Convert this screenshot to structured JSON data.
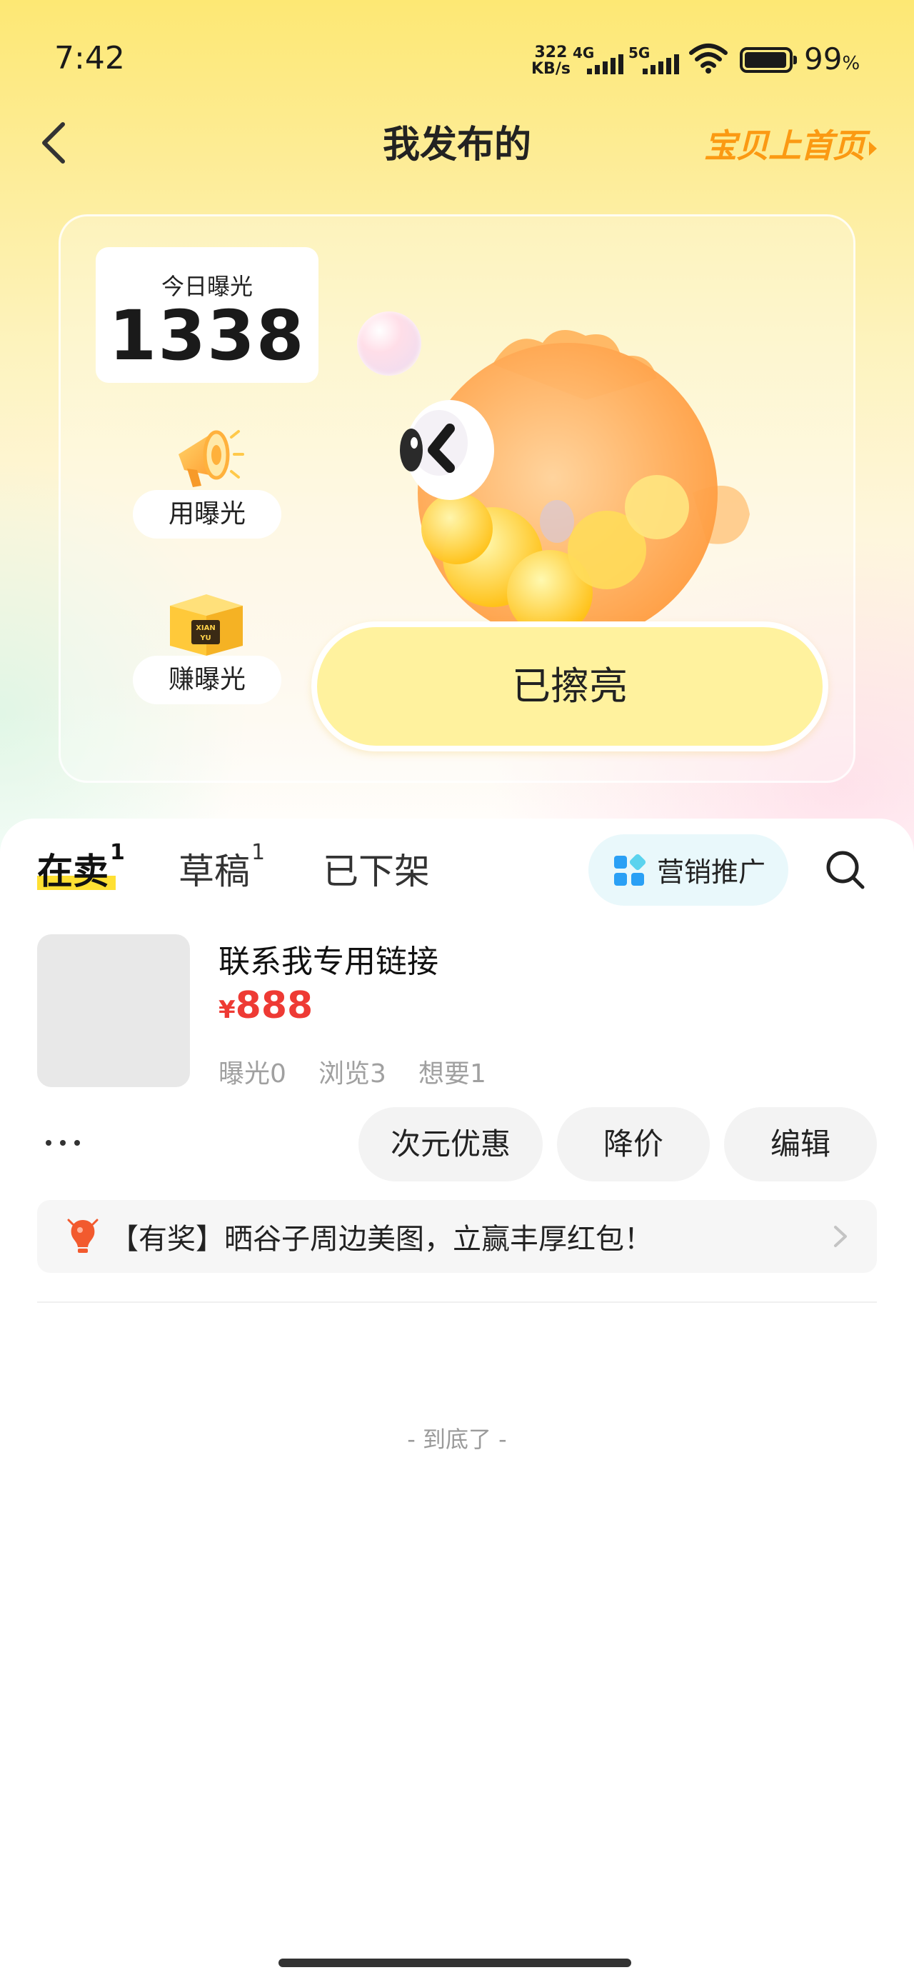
{
  "status_bar": {
    "time": "7:42",
    "net_speed_value": "322",
    "net_speed_unit": "KB/s",
    "signal_1": "4G",
    "signal_2": "5G",
    "battery_percent": "99",
    "battery_suffix": "%"
  },
  "header": {
    "title": "我发布的",
    "right_link": "宝贝上首页"
  },
  "exposure_card": {
    "today_label": "今日曝光",
    "today_value": "1338",
    "use_exposure_label": "用曝光",
    "earn_exposure_label": "赚曝光",
    "box_icon_text_1": "XIAN",
    "box_icon_text_2": "YU",
    "polish_button_label": "已擦亮"
  },
  "tabs": [
    {
      "label": "在卖",
      "count": "1"
    },
    {
      "label": "草稿",
      "count": "1"
    },
    {
      "label": "已下架",
      "count": ""
    }
  ],
  "promo_button_label": "营销推广",
  "item": {
    "title": "联系我专用链接",
    "currency": "¥",
    "price": "888",
    "stats": [
      "曝光0",
      "浏览3",
      "想要1"
    ],
    "actions": [
      "次元优惠",
      "降价",
      "编辑"
    ]
  },
  "banner_text": "【有奖】晒谷子周边美图，立赢丰厚红包！",
  "end_text": "- 到底了 -",
  "colors": {
    "accent_orange": "#fb9a13",
    "price_red": "#ee3a34",
    "tab_underline": "#ffe033",
    "polish_button": "#fff29e"
  },
  "icons": [
    "back-arrow-icon",
    "megaphone-icon",
    "box-icon",
    "grid-apps-icon",
    "search-icon",
    "bulb-icon",
    "chevron-right-icon",
    "more-dots-icon",
    "wifi-icon",
    "battery-icon",
    "signal-icon"
  ]
}
